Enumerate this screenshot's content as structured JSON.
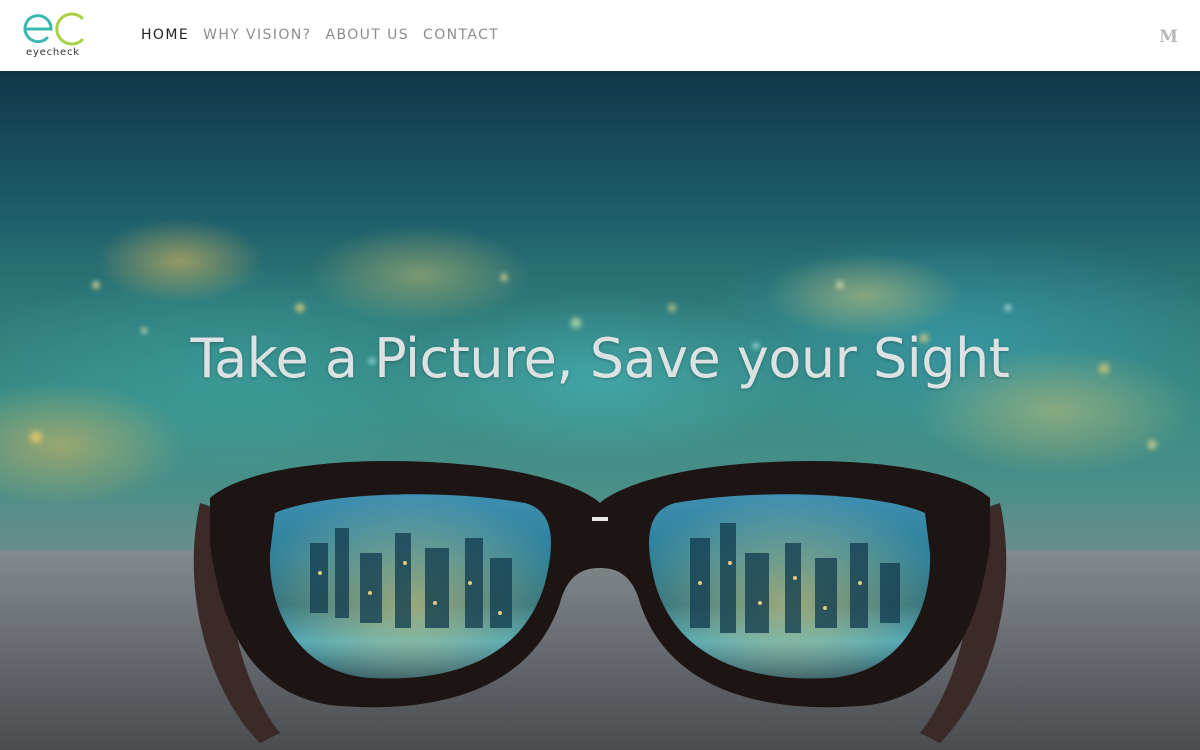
{
  "brand": {
    "name": "eyecheck",
    "mark": "eC",
    "colors": {
      "teal": "#39b8b0",
      "lime": "#a8cf45"
    }
  },
  "nav": {
    "items": [
      {
        "label": "HOME",
        "active": true
      },
      {
        "label": "WHY VISION?",
        "active": false
      },
      {
        "label": "ABOUT US",
        "active": false
      },
      {
        "label": "CONTACT",
        "active": false
      }
    ],
    "menu_icon": {
      "icon": "medium-m-icon",
      "label": "M"
    }
  },
  "hero": {
    "headline": "Take a Picture, Save your Sight",
    "image": "glasses-city-lights"
  }
}
